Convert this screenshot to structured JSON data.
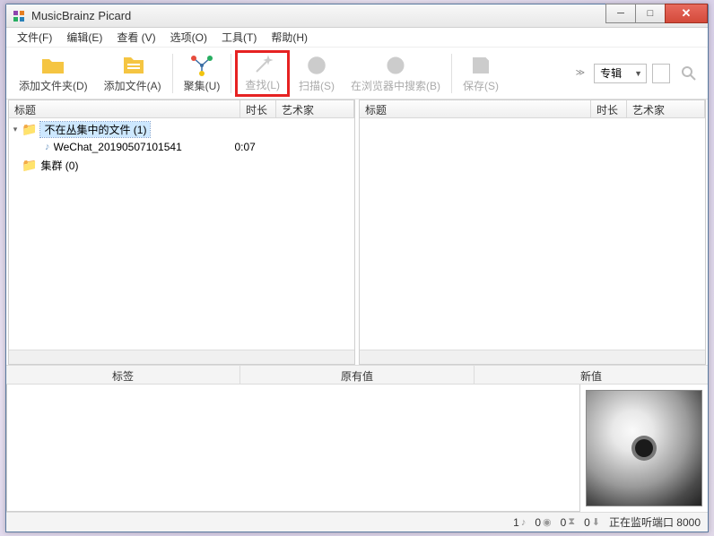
{
  "window": {
    "title": "MusicBrainz Picard"
  },
  "menu": {
    "file": "文件(F)",
    "edit": "编辑(E)",
    "view": "查看 (V)",
    "options": "选项(O)",
    "tools": "工具(T)",
    "help": "帮助(H)"
  },
  "toolbar": {
    "add_folder": "添加文件夹(D)",
    "add_files": "添加文件(A)",
    "cluster": "聚集(U)",
    "lookup": "查找(L)",
    "scan": "扫描(S)",
    "browser_lookup": "在浏览器中搜索(B)",
    "save": "保存(S)",
    "select_value": "专辑"
  },
  "cols": {
    "title": "标题",
    "length": "时长",
    "artist": "艺术家"
  },
  "left": {
    "unclustered": {
      "label": "不在丛集中的文件 (1)",
      "items": [
        {
          "name": "WeChat_20190507101541",
          "length": "0:07"
        }
      ]
    },
    "clusters": {
      "label": "集群 (0)"
    }
  },
  "tags": {
    "tag": "标签",
    "orig": "原有值",
    "newv": "新值"
  },
  "status": {
    "c1": "1",
    "c2": "0",
    "c3": "0",
    "c4": "0",
    "msg": "正在监听端口  8000"
  }
}
